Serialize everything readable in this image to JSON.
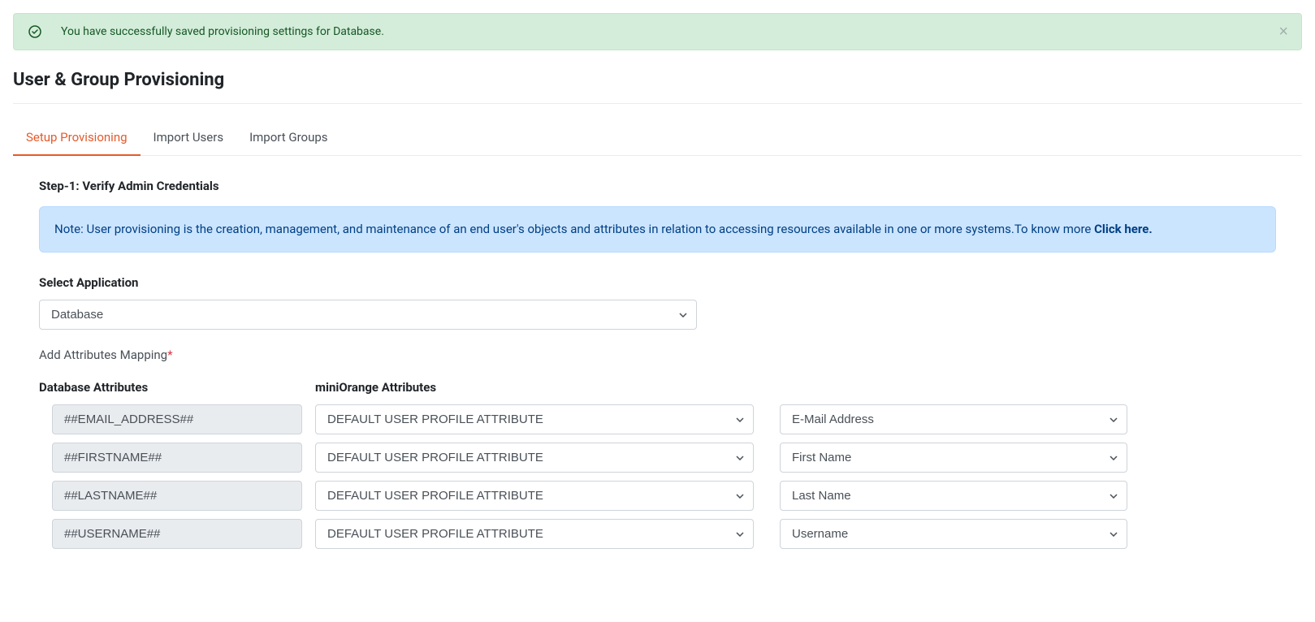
{
  "alert": {
    "message": "You have successfully saved provisioning settings for Database.",
    "close": "×"
  },
  "page": {
    "title": "User & Group Provisioning"
  },
  "tabs": [
    {
      "label": "Setup Provisioning",
      "active": true
    },
    {
      "label": "Import Users",
      "active": false
    },
    {
      "label": "Import Groups",
      "active": false
    }
  ],
  "step": {
    "heading": "Step-1: Verify Admin Credentials"
  },
  "note": {
    "text": "Note: User provisioning is the creation, management, and maintenance of an end user's objects and attributes in relation to accessing resources available in one or more systems.To know more ",
    "linkText": "Click here."
  },
  "form": {
    "selectAppLabel": "Select Application",
    "selectedApp": "Database",
    "mappingLabel": "Add Attributes Mapping",
    "colDb": "Database Attributes",
    "colMo": "miniOrange Attributes"
  },
  "mappings": [
    {
      "db": "##EMAIL_ADDRESS##",
      "type": "DEFAULT USER PROFILE ATTRIBUTE",
      "value": "E-Mail Address"
    },
    {
      "db": "##FIRSTNAME##",
      "type": "DEFAULT USER PROFILE ATTRIBUTE",
      "value": "First Name"
    },
    {
      "db": "##LASTNAME##",
      "type": "DEFAULT USER PROFILE ATTRIBUTE",
      "value": "Last Name"
    },
    {
      "db": "##USERNAME##",
      "type": "DEFAULT USER PROFILE ATTRIBUTE",
      "value": "Username"
    }
  ]
}
